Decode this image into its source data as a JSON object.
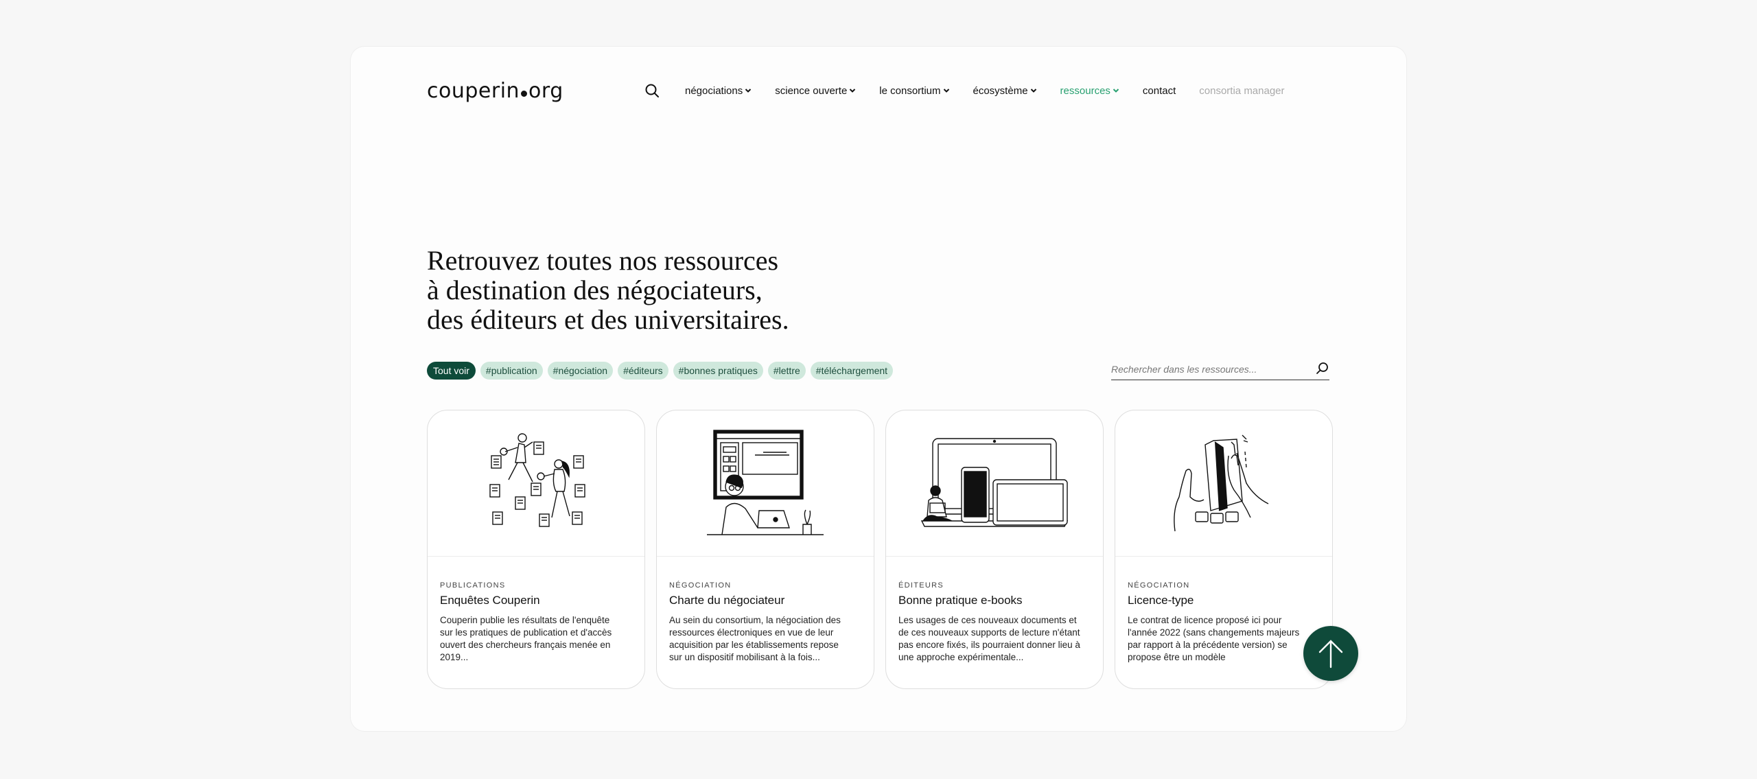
{
  "logo": {
    "part1": "couperin",
    "part2": "org"
  },
  "nav": {
    "items": [
      {
        "label": "négociations"
      },
      {
        "label": "science ouverte"
      },
      {
        "label": "le consortium"
      },
      {
        "label": "écosystème"
      },
      {
        "label": "ressources"
      },
      {
        "label": "contact"
      },
      {
        "label": "consortia manager"
      }
    ]
  },
  "hero": {
    "line1": "Retrouvez toutes nos ressources",
    "line2": "à destination des négociateurs,",
    "line3": "des éditeurs et des universitaires."
  },
  "filters": [
    "Tout voir",
    "#publication",
    "#négociation",
    "#éditeurs",
    "#bonnes pratiques",
    "#lettre",
    "#téléchargement"
  ],
  "search": {
    "placeholder": "Rechercher dans les ressources..."
  },
  "cards": [
    {
      "category": "PUBLICATIONS",
      "title": "Enquêtes Couperin",
      "description": "Couperin publie les résultats de l'enquête sur les pratiques de publication et d'accès ouvert des chercheurs français menée en 2019..."
    },
    {
      "category": "NÉGOCIATION",
      "title": "Charte du négociateur",
      "description": "Au sein du consortium, la négociation des ressources électroniques en vue de leur acquisition par les établissements repose sur un dispositif mobilisant à la fois..."
    },
    {
      "category": "ÉDITEURS",
      "title": "Bonne pratique e-books",
      "description": "Les usages de ces nouveaux documents et de ces nouveaux supports de lecture n'étant pas encore fixés, ils pourraient donner lieu à une approche expérimentale..."
    },
    {
      "category": "NÉGOCIATION",
      "title": "Licence-type",
      "description": "Le contrat de licence proposé ici pour l'année 2022 (sans changements majeurs par rapport à la précédente version) se propose être un modèle"
    }
  ],
  "colors": {
    "accent": "#28a070",
    "dark_green": "#0e4b3a",
    "tag_bg": "#cfe8dc"
  },
  "icons": {
    "search": "search-icon",
    "chevron": "chevron-down-icon",
    "back_to_top": "arrow-up-icon"
  }
}
